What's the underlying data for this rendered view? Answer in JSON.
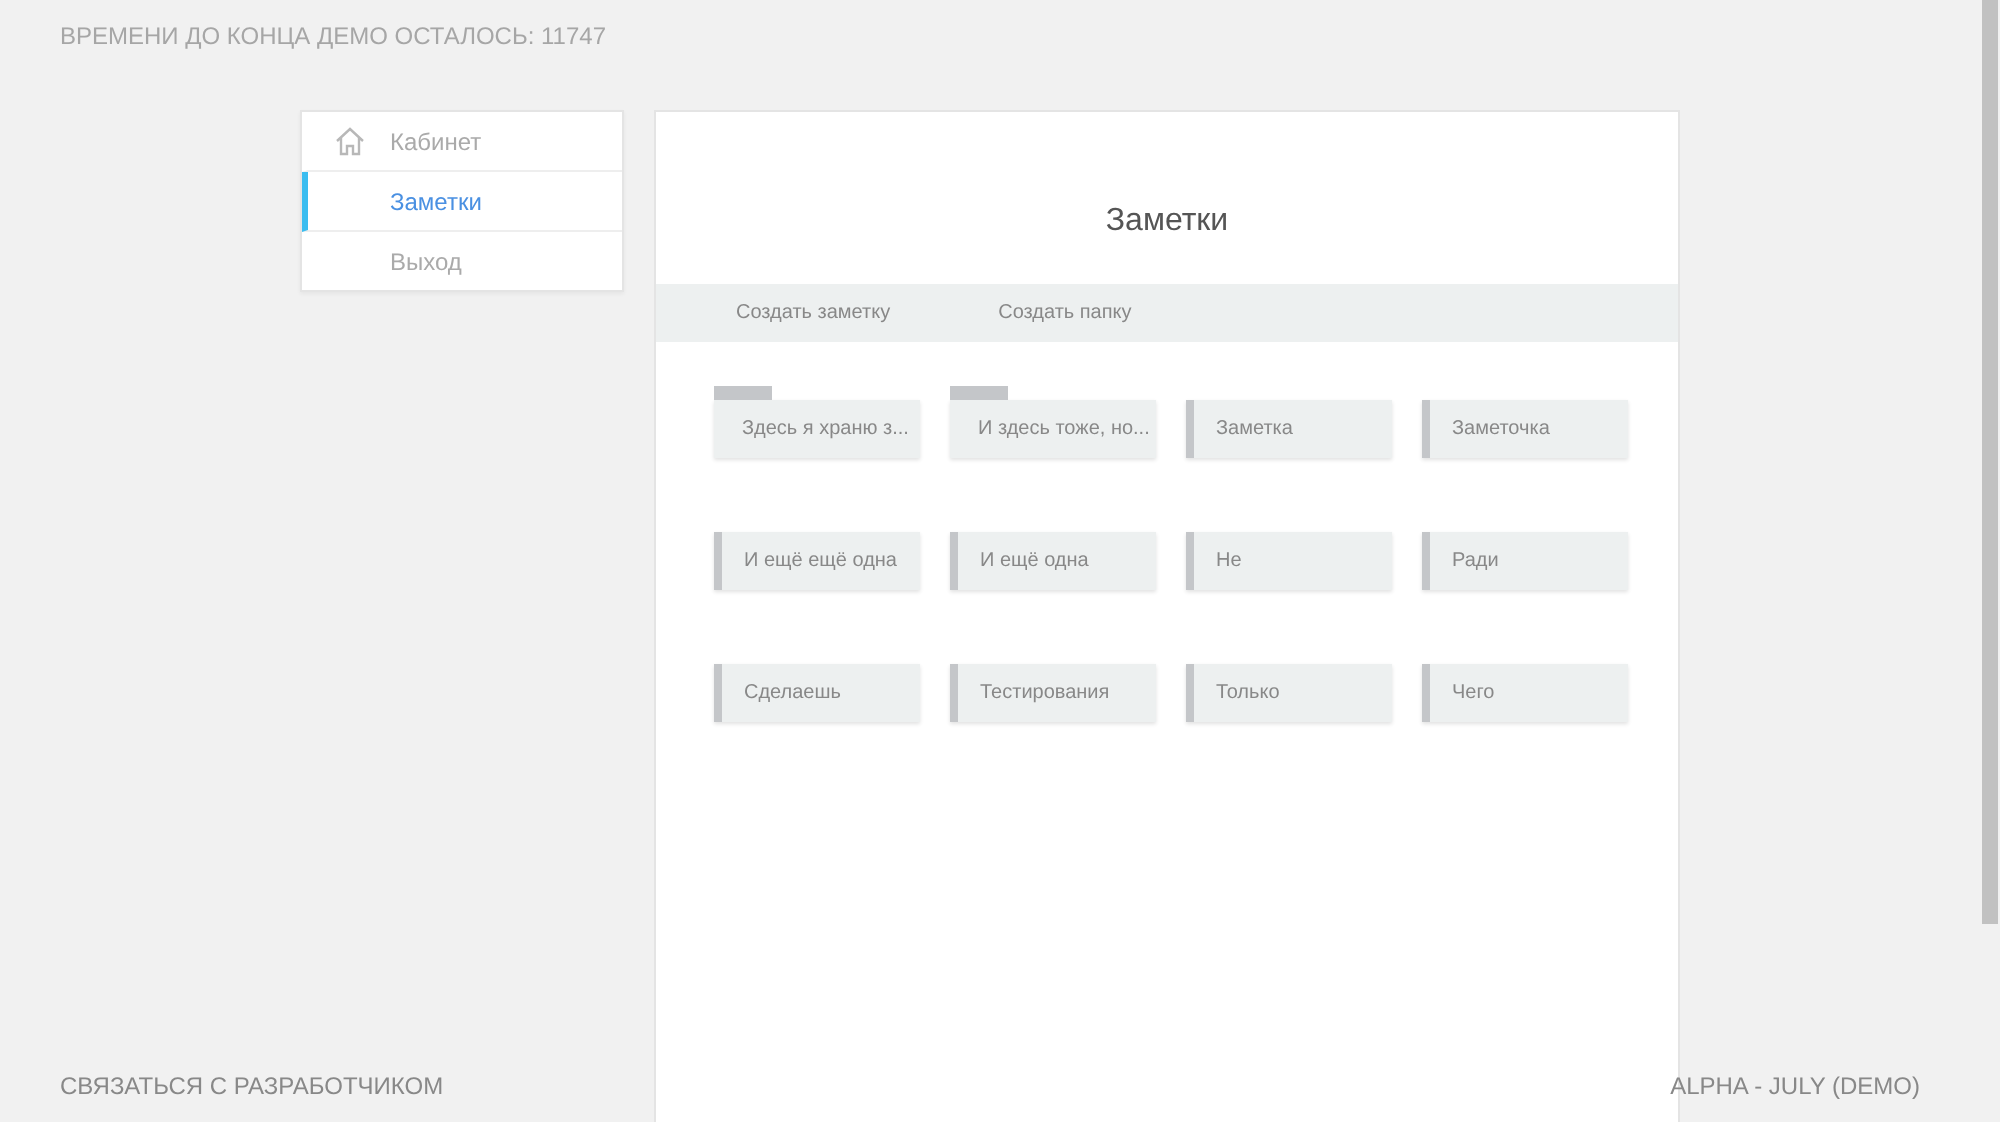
{
  "demo_timer": "ВРЕМЕНИ ДО КОНЦА ДЕМО ОСТАЛОСЬ: 11747",
  "sidebar": {
    "items": [
      {
        "label": "Кабинет",
        "selected": false
      },
      {
        "label": "Заметки",
        "selected": true
      },
      {
        "label": "Выход",
        "selected": false
      }
    ]
  },
  "main": {
    "title": "Заметки",
    "toolbar": [
      "Создать заметку",
      "Создать папку"
    ],
    "items": [
      {
        "kind": "folder",
        "label": "Здесь я храню з..."
      },
      {
        "kind": "folder",
        "label": "И здесь тоже, но..."
      },
      {
        "kind": "note",
        "label": "Заметка"
      },
      {
        "kind": "note",
        "label": "Заметочка"
      },
      {
        "kind": "note",
        "label": "И ещё ещё одна"
      },
      {
        "kind": "note",
        "label": "И ещё одна"
      },
      {
        "kind": "note",
        "label": "Не"
      },
      {
        "kind": "note",
        "label": "Ради"
      },
      {
        "kind": "note",
        "label": "Сделаешь"
      },
      {
        "kind": "note",
        "label": "Тестирования"
      },
      {
        "kind": "note",
        "label": "Только"
      },
      {
        "kind": "note",
        "label": "Чего"
      }
    ]
  },
  "footer": {
    "contact": "СВЯЗАТЬСЯ С РАЗРАБОТЧИКОМ",
    "version": "ALPHA - JULY (DEMO)"
  }
}
